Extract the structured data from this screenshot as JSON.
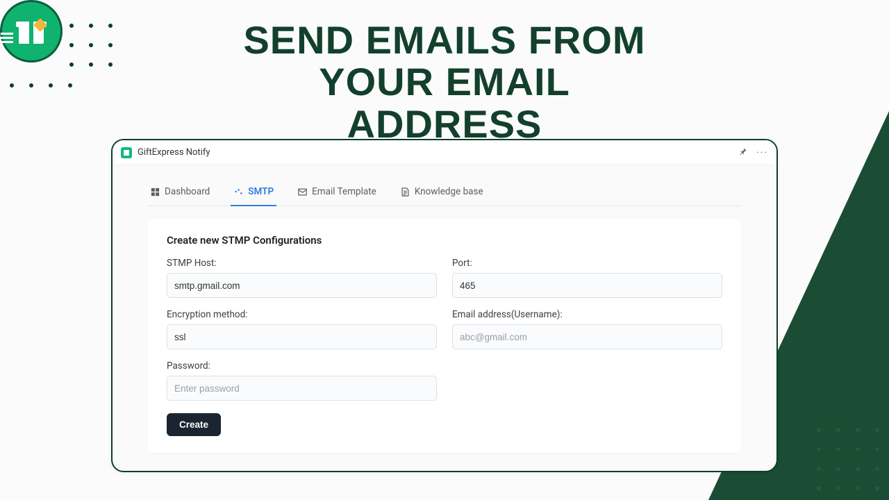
{
  "heading": {
    "line1": "Send emails from",
    "line2": "your email address"
  },
  "window": {
    "title": "GiftExpress Notify"
  },
  "tabs": [
    {
      "label": "Dashboard"
    },
    {
      "label": "SMTP"
    },
    {
      "label": "Email Template"
    },
    {
      "label": "Knowledge base"
    }
  ],
  "form": {
    "title": "Create new STMP Configurations",
    "fields": {
      "host": {
        "label": "STMP Host:",
        "value": "smtp.gmail.com"
      },
      "port": {
        "label": "Port:",
        "value": "465"
      },
      "encryption": {
        "label": "Encryption method:",
        "value": "ssl"
      },
      "email": {
        "label": "Email address(Username):",
        "placeholder": "abc@gmail.com"
      },
      "password": {
        "label": "Password:",
        "placeholder": "Enter password"
      }
    },
    "submit_label": "Create"
  },
  "colors": {
    "brand_green": "#0c5d41",
    "accent_blue": "#2f7be5",
    "button_dark": "#1a2530"
  }
}
